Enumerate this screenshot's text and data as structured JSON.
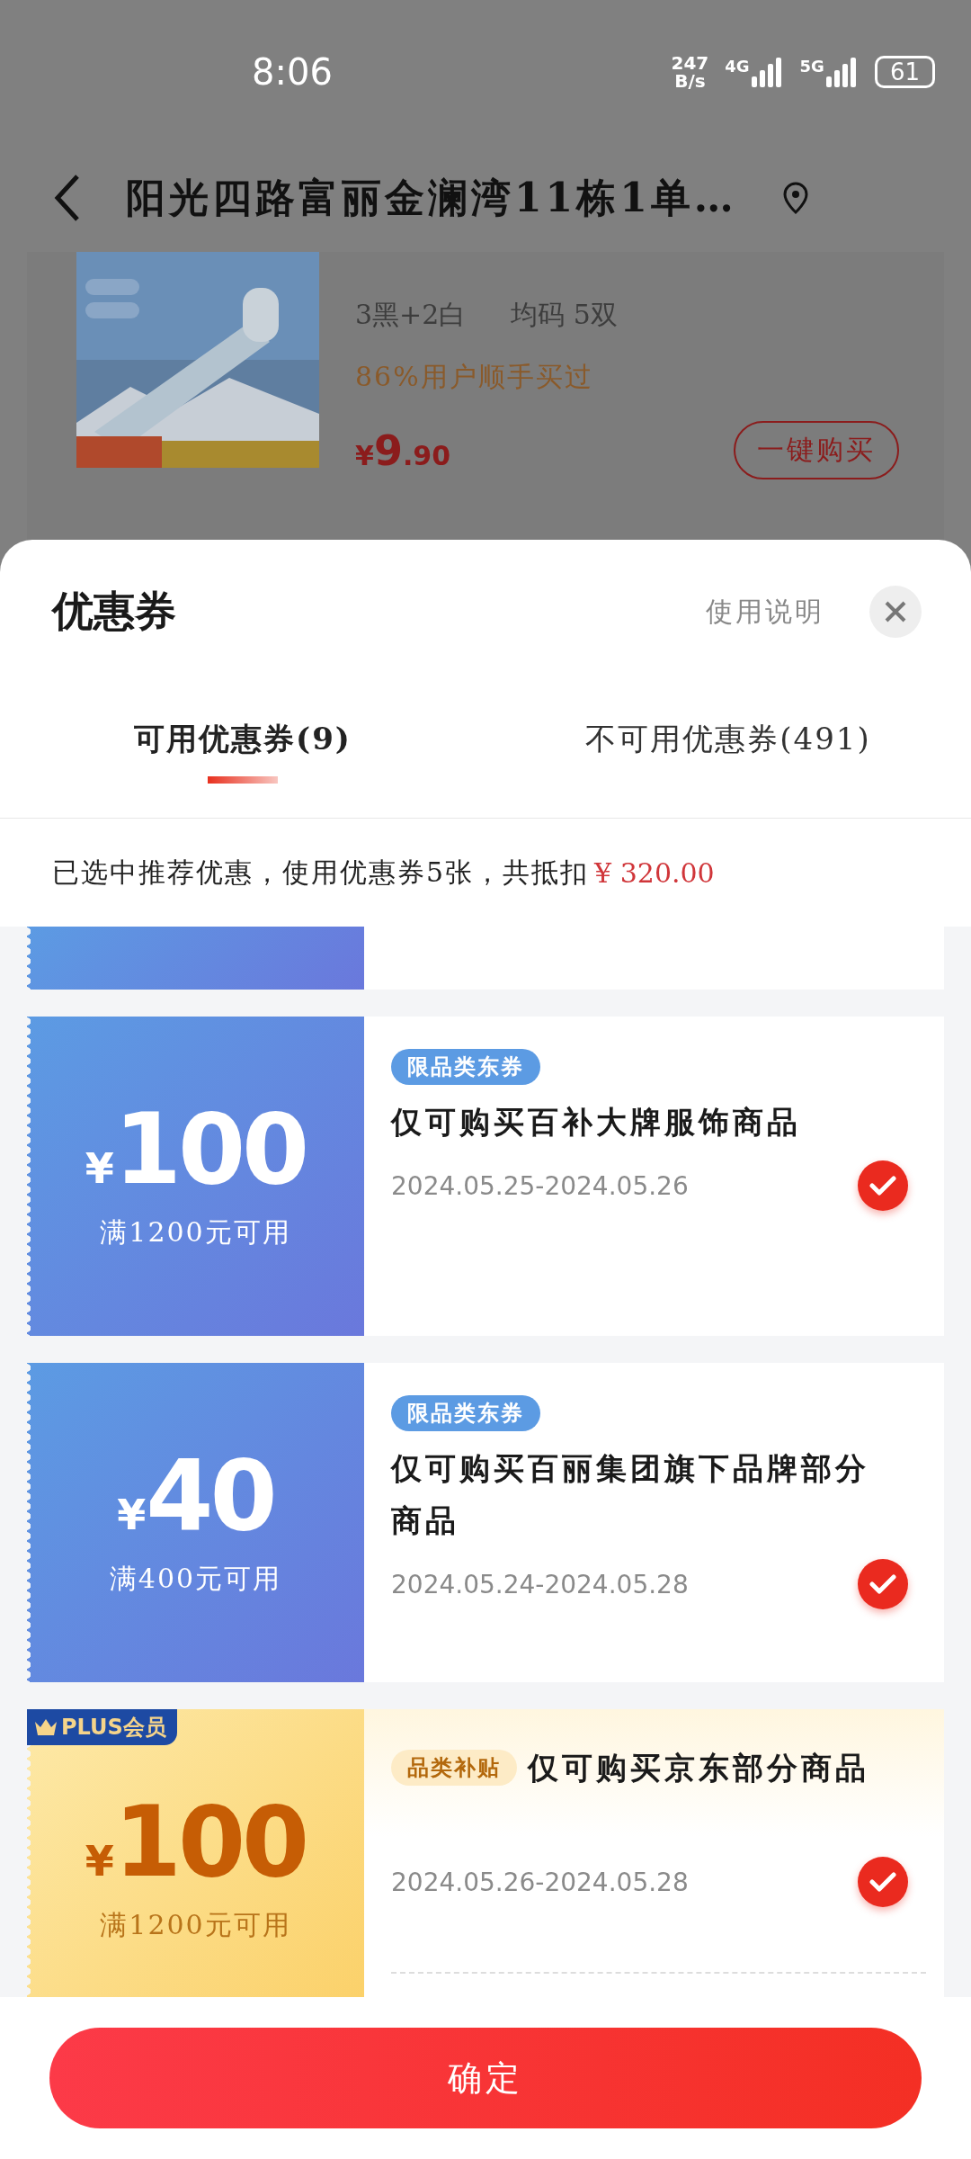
{
  "status_bar": {
    "time": "8:06",
    "net_speed": {
      "value": "247",
      "unit": "B/s"
    },
    "networks": [
      "4G",
      "5G"
    ],
    "battery": "61"
  },
  "header": {
    "title": "阳光四路富丽金澜湾11栋1单…"
  },
  "product": {
    "kind": "picture",
    "spec": "3黑+2白",
    "size": "均码 5双",
    "hint": "86%用户顺手买过",
    "price": {
      "currency": "¥",
      "integer": "9",
      "decimal": ".90"
    },
    "buy_button": "一键购买"
  },
  "sheet": {
    "title": "优惠券",
    "help_link": "使用说明",
    "tabs": [
      {
        "label": "可用优惠券(9)",
        "selected": true
      },
      {
        "label": "不可用优惠券(491)",
        "selected": false
      }
    ],
    "summary": {
      "text": "已选中推荐优惠，使用优惠券5张，共抵扣",
      "amount": "¥ 320.00"
    },
    "coupons": [
      {
        "kind": "cut"
      },
      {
        "kind": "standard",
        "currency": "¥",
        "amount": "100",
        "condition": "满1200元可用",
        "tag": "限品类东券",
        "description": "仅可购买百补大牌服饰商品",
        "validity": "2024.05.25-2024.05.26",
        "checked": true
      },
      {
        "kind": "standard",
        "currency": "¥",
        "amount": "40",
        "condition": "满400元可用",
        "tag": "限品类东券",
        "description": "仅可购买百丽集团旗下品牌部分商品",
        "validity": "2024.05.24-2024.05.28",
        "checked": true
      },
      {
        "kind": "plus",
        "badge": "PLUS会员",
        "currency": "¥",
        "amount": "100",
        "condition": "满1200元可用",
        "tag": "品类补贴",
        "description": "仅可购买京东部分商品",
        "validity": "2024.05.26-2024.05.28",
        "checked": true
      }
    ],
    "confirm_button": "确定"
  }
}
